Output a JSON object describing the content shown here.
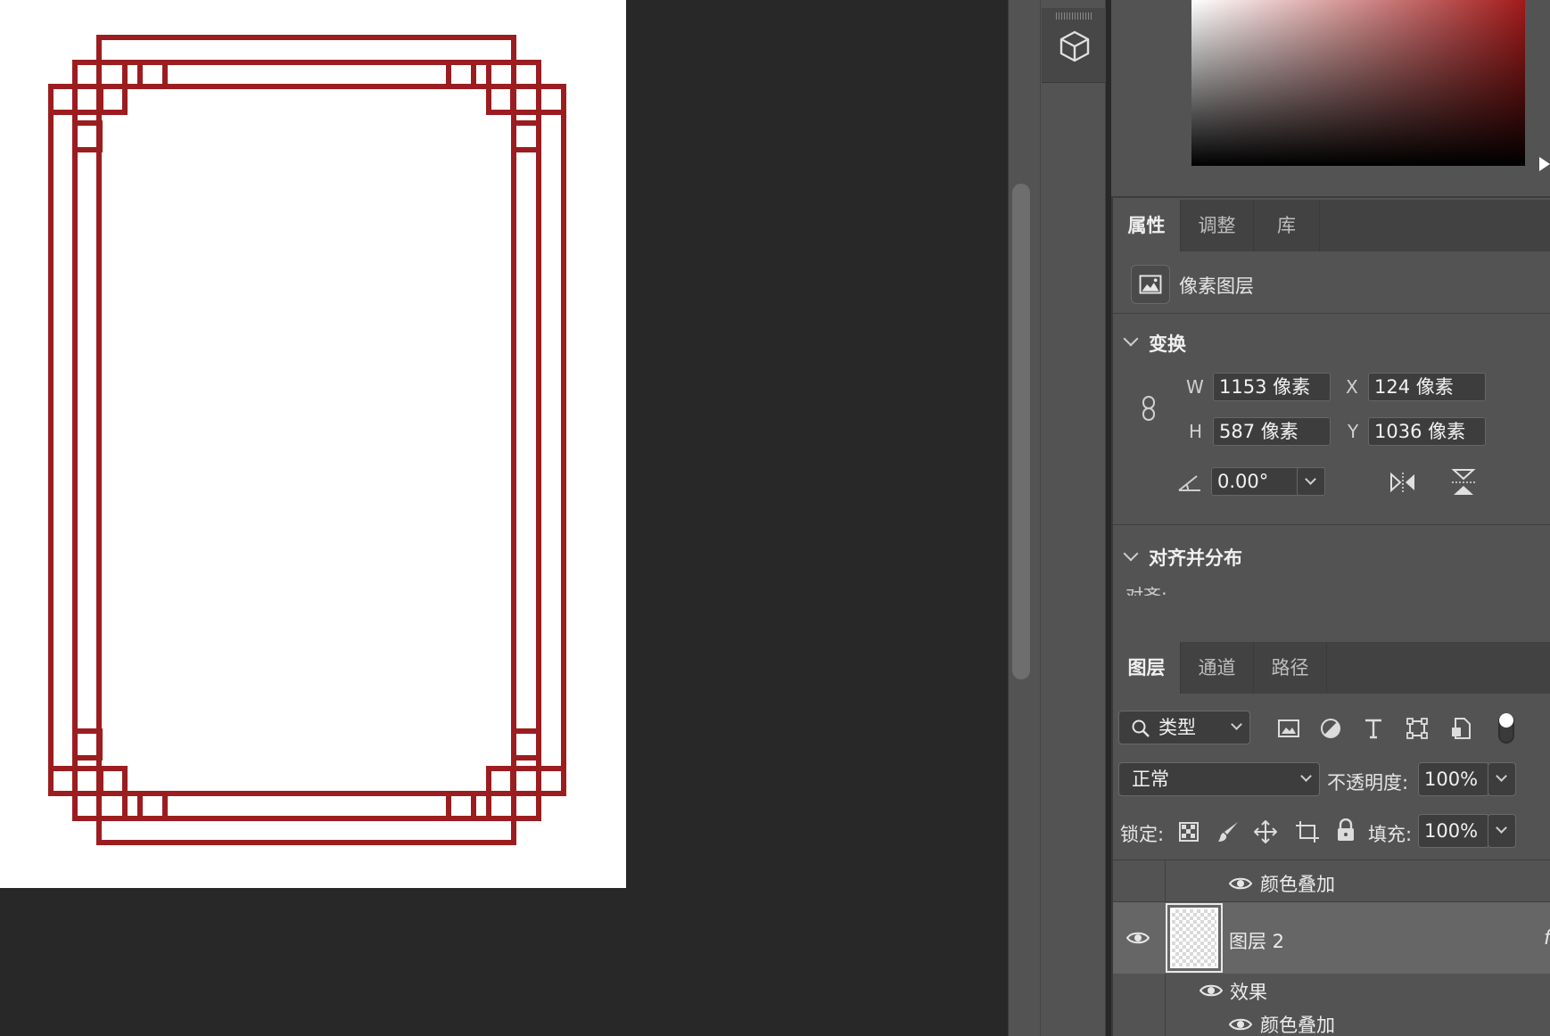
{
  "colors": {
    "frame_red": "#9b1d20",
    "panel_bg": "#535353",
    "tab_bar_bg": "#424242",
    "canvas_bg": "#282828"
  },
  "tool_strip": {
    "icon": "3d-cube-icon"
  },
  "properties_tabs": [
    {
      "label": "属性",
      "active": true
    },
    {
      "label": "调整",
      "active": false
    },
    {
      "label": "库",
      "active": false
    }
  ],
  "properties": {
    "layer_type_icon": "pixel-layer-icon",
    "layer_type": "像素图层",
    "transform": {
      "title": "变换",
      "w_label": "W",
      "w_value": "1153 像素",
      "x_label": "X",
      "x_value": "124 像素",
      "h_label": "H",
      "h_value": "587 像素",
      "y_label": "Y",
      "y_value": "1036 像素",
      "angle_value": "0.00°"
    },
    "align": {
      "title": "对齐并分布",
      "subtitle": "对齐:"
    }
  },
  "layers_tabs": [
    {
      "label": "图层",
      "active": true
    },
    {
      "label": "通道",
      "active": false
    },
    {
      "label": "路径",
      "active": false
    }
  ],
  "layers": {
    "filter_kind": "类型",
    "blend_mode": "正常",
    "opacity_label": "不透明度:",
    "opacity_value": "100%",
    "lock_label": "锁定:",
    "fill_label": "填充:",
    "fill_value": "100%",
    "rows": [
      {
        "name": "颜色叠加",
        "type": "effect"
      },
      {
        "name": "图层 2",
        "type": "layer",
        "selected": true
      },
      {
        "name": "效果",
        "type": "effects-group"
      },
      {
        "name": "颜色叠加",
        "type": "effect"
      }
    ]
  }
}
